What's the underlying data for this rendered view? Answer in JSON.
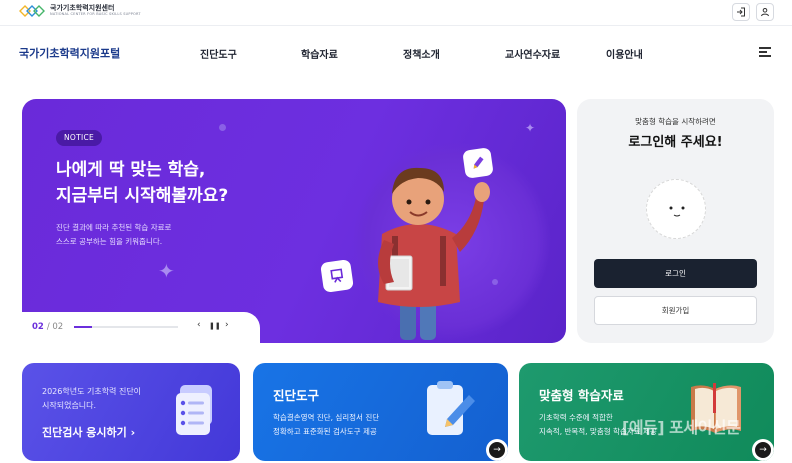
{
  "header": {
    "logo_title": "국가기초학력지원센터",
    "logo_sub": "NATIONAL CENTER FOR BASIC SKILLS SUPPORT",
    "login_icon": "login-icon",
    "user_icon": "user-icon"
  },
  "nav": {
    "brand": "국가기초학력지원포털",
    "items": [
      "진단도구",
      "학습자료",
      "정책소개",
      "교사연수자료",
      "이용안내"
    ],
    "menu_icon": "hamburger-menu-icon"
  },
  "hero": {
    "badge": "NOTICE",
    "title_line1": "나에게 딱 맞는 학습,",
    "title_line2": "지금부터 시작해볼까요?",
    "desc_line1": "진단 결과에 따라 추천된 학습 자료로",
    "desc_line2": "스스로 공부하는 힘을 키워줍니다.",
    "pager_current": "02",
    "pager_total": "/ 02",
    "progress": 0.17,
    "prev": "‹",
    "pause": "❚❚",
    "next": "›"
  },
  "login": {
    "subtitle": "맞춤형 학습을 시작하려면",
    "title": "로그인해 주세요!",
    "login_button": "로그인",
    "join_button": "회원가입"
  },
  "cards": [
    {
      "line1": "2026학년도 기초학력 진단이",
      "line2": "시작되었습니다.",
      "cta": "진단검사 응시하기 ›"
    },
    {
      "title": "진단도구",
      "desc1": "학습결손영역 진단, 심리정서 진단",
      "desc2": "정확하고 표준화된 검사도구 제공",
      "arrow": "→"
    },
    {
      "title": "맞춤형 학습자료",
      "desc1": "기초학력 수준에 적합한",
      "desc2": "지속적, 반복적, 맞춤형 학습자료 제공",
      "arrow": "→"
    }
  ],
  "watermark": "[에듀] 포세이신문",
  "colors": {
    "hero_purple": "#6a2ad9",
    "brand_blue": "#1b3a8b",
    "card_blue": "#1874e6",
    "card_green": "#1e9a6e",
    "card_indigo": "#5a52e8",
    "dark_button": "#1a2230"
  }
}
